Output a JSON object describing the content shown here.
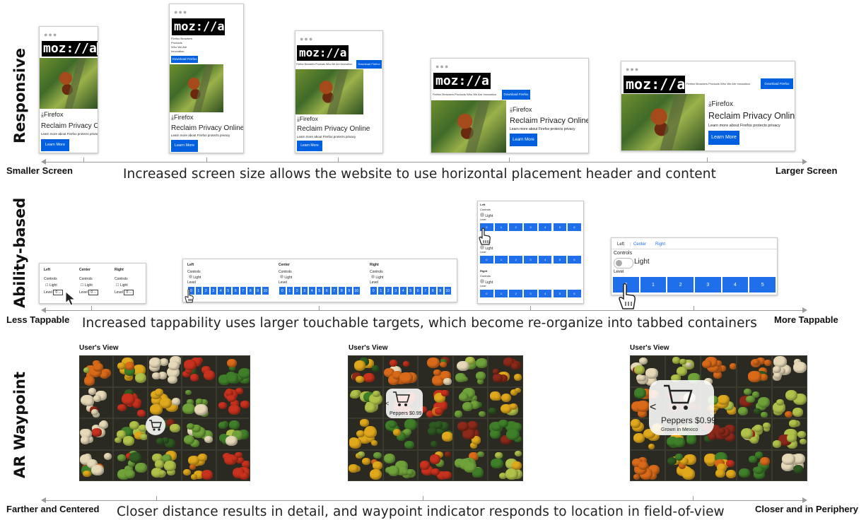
{
  "rows": {
    "responsive": "Responsive",
    "ability": "Ability-based",
    "ar": "AR Waypoint"
  },
  "axes": {
    "responsive": {
      "left": "Smaller Screen",
      "right": "Larger Screen",
      "caption": "Increased screen size allows the website to use horizontal placement header and content"
    },
    "ability": {
      "left": "Less Tappable",
      "right": "More Tappable",
      "caption": "Increased tappability uses larger touchable targets, which become re-organize into tabbed containers"
    },
    "ar": {
      "left": "Farther and Centered",
      "right": "Closer and in Periphery",
      "caption": "Closer distance results in detail, and waypoint indicator responds to location in field-of-view"
    }
  },
  "mockup": {
    "dots": "●●●",
    "logo": "moz://a",
    "nav": [
      "Firefox Browsers",
      "Products",
      "Who We Are",
      "Innovation"
    ],
    "nav_inline": "Firefox Browsers Products Who We Are Innovation",
    "download": "Download Firefox",
    "product": "Firefox",
    "headline": "Reclaim Privacy Online",
    "sub": "Learn more about Firefox protects privacy",
    "cta": "Learn More"
  },
  "ability": {
    "columns": [
      "Left",
      "Center",
      "Right"
    ],
    "controls": "Controls",
    "light": "Light",
    "level": "Level",
    "select_value": "0",
    "levels10": [
      "0",
      "1",
      "2",
      "3",
      "4",
      "5",
      "6",
      "7",
      "8",
      "9",
      "10"
    ],
    "levels7": [
      "0",
      "1",
      "2",
      "3",
      "4",
      "5",
      "6"
    ],
    "levels6": [
      "0",
      "1",
      "2",
      "3",
      "4",
      "5"
    ],
    "tabs": [
      "Left",
      "Center",
      "Right"
    ]
  },
  "ar": {
    "users_view": "User's View",
    "small_label": "Peppers $0.99",
    "big_label": "Peppers $0.99",
    "big_sub": "Grown in Mexico",
    "chevron": "<"
  },
  "colors": {
    "accent": "#1f6feb",
    "axis": "#9a9a9a"
  }
}
